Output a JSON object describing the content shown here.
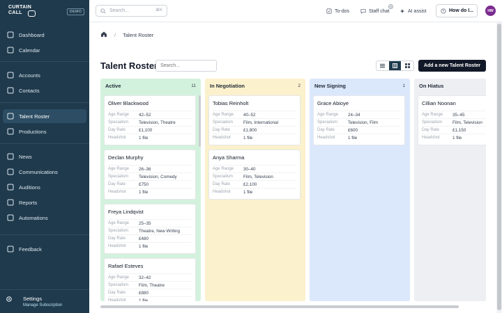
{
  "app": {
    "logo_line1": "CURTAIN",
    "logo_line2": "CALL",
    "demo_badge": "DEMO"
  },
  "sidebar": {
    "groups": [
      [
        {
          "label": "Dashboard",
          "icon": "dashboard-icon"
        },
        {
          "label": "Calendar",
          "icon": "calendar-icon"
        }
      ],
      [
        {
          "label": "Accounts",
          "icon": "accounts-icon"
        },
        {
          "label": "Contacts",
          "icon": "contacts-icon"
        }
      ],
      [
        {
          "label": "Talent Roster",
          "icon": "talent-icon",
          "active": true
        },
        {
          "label": "Productions",
          "icon": "productions-icon"
        }
      ],
      [
        {
          "label": "News",
          "icon": "news-icon"
        },
        {
          "label": "Communications",
          "icon": "communications-icon"
        },
        {
          "label": "Auditions",
          "icon": "auditions-icon"
        },
        {
          "label": "Reports",
          "icon": "reports-icon"
        },
        {
          "label": "Automations",
          "icon": "automations-icon"
        }
      ],
      [
        {
          "label": "Feedback",
          "icon": "feedback-icon"
        }
      ]
    ],
    "settings_label": "Settings",
    "settings_sub": "Manage Subscription"
  },
  "topbar": {
    "search_placeholder": "Search...",
    "search_shortcut": "⌘K",
    "todos": "To-dos",
    "staff_chat": "Staff chat",
    "staff_chat_count": "0",
    "ai_assist": "AI assist",
    "how_do_i": "How do I...",
    "avatar_initials": "HW"
  },
  "breadcrumb": {
    "current": "Talent Roster"
  },
  "page": {
    "title": "Talent Roster",
    "search_placeholder": "Search...",
    "add_button": "Add a new Talent Roster"
  },
  "field_labels": {
    "age_range": "Age Range",
    "specialism": "Specialism",
    "day_rate": "Day Rate",
    "headshot": "Headshot"
  },
  "columns": [
    {
      "title": "Active",
      "count": "11",
      "color": "#d3f2dd",
      "cards": [
        {
          "name": "Oliver Blackwood",
          "age_range": "42–52",
          "specialism": "Television, Theatre",
          "day_rate": "£1,100",
          "headshot": "1 file"
        },
        {
          "name": "Declan Murphy",
          "age_range": "26–36",
          "specialism": "Television, Comedy",
          "day_rate": "£750",
          "headshot": "1 file"
        },
        {
          "name": "Freya Lindqvist",
          "age_range": "25–35",
          "specialism": "Theatre, New Writing",
          "day_rate": "£480",
          "headshot": "1 file"
        },
        {
          "name": "Rafael Esteves",
          "age_range": "32–42",
          "specialism": "Film, Theatre",
          "day_rate": "£880",
          "headshot": "1 file"
        }
      ]
    },
    {
      "title": "In Negotiation",
      "count": "2",
      "color": "#fbf1cc",
      "cards": [
        {
          "name": "Tobias Reinholt",
          "age_range": "40–52",
          "specialism": "Film, International",
          "day_rate": "£1,800",
          "headshot": "1 file"
        },
        {
          "name": "Anya Sharma",
          "age_range": "30–40",
          "specialism": "Film, Television",
          "day_rate": "£2,100",
          "headshot": "1 file"
        }
      ]
    },
    {
      "title": "New Signing",
      "count": "1",
      "color": "#dbe7fb",
      "cards": [
        {
          "name": "Grace Abioye",
          "age_range": "24–34",
          "specialism": "Television, Film",
          "day_rate": "£600",
          "headshot": "1 file"
        }
      ]
    },
    {
      "title": "On Hiatus",
      "count": "",
      "color": "#eeeff2",
      "cards": [
        {
          "name": "Cillian Noonan",
          "age_range": "35–45",
          "specialism": "Film, Television",
          "day_rate": "£1,150",
          "headshot": "1 file"
        }
      ]
    }
  ]
}
